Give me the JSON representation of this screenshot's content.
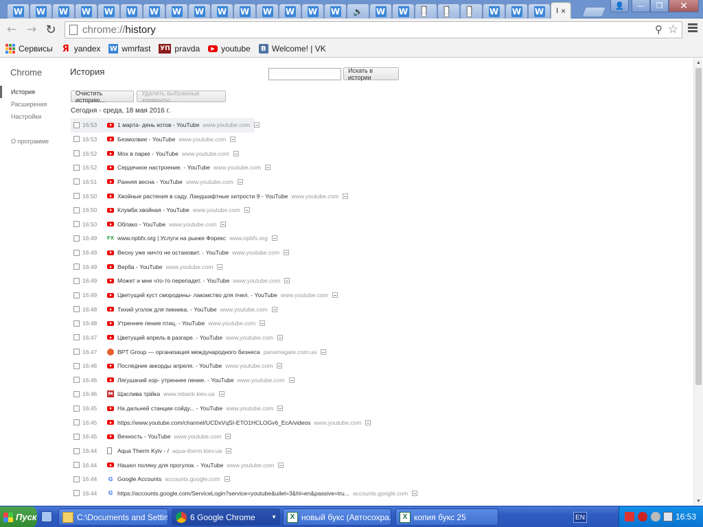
{
  "tabstrip": {
    "tabs": [
      {
        "icon": "wmrfast-icon",
        "glyph": "W"
      },
      {
        "icon": "wmrfast-icon",
        "glyph": "W"
      },
      {
        "icon": "wmrfast-icon",
        "glyph": "W"
      },
      {
        "icon": "wmrfast-icon",
        "glyph": "W"
      },
      {
        "icon": "wmrfast-icon",
        "glyph": "W"
      },
      {
        "icon": "wmrfast-icon",
        "glyph": "W"
      },
      {
        "icon": "wmrfast-icon",
        "glyph": "W"
      },
      {
        "icon": "wmrfast-icon",
        "glyph": "W"
      },
      {
        "icon": "wmrfast-icon",
        "glyph": "W"
      },
      {
        "icon": "wmrfast-icon",
        "glyph": "W"
      },
      {
        "icon": "wmrfast-icon",
        "glyph": "W"
      },
      {
        "icon": "wmrfast-icon",
        "glyph": "W"
      },
      {
        "icon": "wmrfast-icon",
        "glyph": "W"
      },
      {
        "icon": "wmrfast-icon",
        "glyph": "W"
      },
      {
        "icon": "wmrfast-icon",
        "glyph": "W"
      },
      {
        "icon": "speaker-icon",
        "glyph": "🔈"
      },
      {
        "icon": "wmrfast-icon",
        "glyph": "W"
      },
      {
        "icon": "wmrfast-icon",
        "glyph": "W"
      },
      {
        "icon": "page-icon",
        "glyph": "🗋"
      },
      {
        "icon": "page-icon",
        "glyph": "🗋"
      },
      {
        "icon": "page-icon",
        "glyph": "🗋"
      },
      {
        "icon": "wmrfast-icon",
        "glyph": "W"
      },
      {
        "icon": "wmrfast-icon",
        "glyph": "W"
      },
      {
        "icon": "wmrfast-icon",
        "glyph": "W"
      }
    ],
    "active_tab": {
      "title": "I",
      "close": "×"
    }
  },
  "toolbar": {
    "url_scheme": "chrome://",
    "url_path": "history"
  },
  "bookmarks": [
    {
      "label": "Сервисы",
      "icon": "apps-icon",
      "glyph": ""
    },
    {
      "label": "yandex",
      "icon": "yandex-icon",
      "glyph": "Я"
    },
    {
      "label": "wmrfast",
      "icon": "wmrfast-icon",
      "glyph": "W"
    },
    {
      "label": "pravda",
      "icon": "up-icon",
      "glyph": "УП"
    },
    {
      "label": "youtube",
      "icon": "youtube-icon",
      "glyph": "▶"
    },
    {
      "label": "Welcome! | VK",
      "icon": "vk-icon",
      "glyph": "B"
    }
  ],
  "sidebar": {
    "brand": "Chrome",
    "items": [
      {
        "label": "История",
        "selected": true
      },
      {
        "label": "Расширения",
        "selected": false
      },
      {
        "label": "Настройки",
        "selected": false
      }
    ],
    "about": "О программе"
  },
  "history": {
    "heading": "История",
    "search_placeholder": "",
    "search_button": "Искать в истории",
    "clear_button": "Очистить историю...",
    "remove_button": "Удалить выбранные элементы",
    "day_header": "Сегодня - среда, 18 мая 2016 г.",
    "entries": [
      {
        "time": "16:53",
        "favicon": "youtube",
        "title": "1 марта- день котов - YouTube",
        "domain": "www.youtube.com"
      },
      {
        "time": "16:53",
        "favicon": "youtube",
        "title": "Безмолвие - YouTube",
        "domain": "www.youtube.com"
      },
      {
        "time": "16:52",
        "favicon": "youtube",
        "title": "Мох в парке - YouTube",
        "domain": "www.youtube.com"
      },
      {
        "time": "16:52",
        "favicon": "youtube",
        "title": "Сердечное настроение. - YouTube",
        "domain": "www.youtube.com"
      },
      {
        "time": "16:51",
        "favicon": "youtube",
        "title": "Ранняя весна - YouTube",
        "domain": "www.youtube.com"
      },
      {
        "time": "16:50",
        "favicon": "youtube",
        "title": "Хвойные растения в саду. Ландшафтные хитрости 9 - YouTube",
        "domain": "www.youtube.com"
      },
      {
        "time": "16:50",
        "favicon": "youtube",
        "title": "Клумба хвойная - YouTube",
        "domain": "www.youtube.com"
      },
      {
        "time": "16:50",
        "favicon": "youtube",
        "title": "Облако - YouTube",
        "domain": "www.youtube.com"
      },
      {
        "time": "16:49",
        "favicon": "fx",
        "title": "www.npbfx.org | Услуги на рынке Форекс",
        "domain": "www.npbfx.org"
      },
      {
        "time": "16:49",
        "favicon": "youtube",
        "title": "Весну уже ничто не остановит. - YouTube",
        "domain": "www.youtube.com"
      },
      {
        "time": "16:49",
        "favicon": "youtube",
        "title": "Верба - YouTube",
        "domain": "www.youtube.com"
      },
      {
        "time": "16:49",
        "favicon": "youtube",
        "title": "Может и мне что-то перепадет. - YouTube",
        "domain": "www.youtube.com"
      },
      {
        "time": "16:49",
        "favicon": "youtube",
        "title": "Цветущий куст смородины- лакомство для пчел. - YouTube",
        "domain": "www.youtube.com"
      },
      {
        "time": "16:48",
        "favicon": "youtube",
        "title": "Тихий уголок для пикника. - YouTube",
        "domain": "www.youtube.com"
      },
      {
        "time": "16:48",
        "favicon": "youtube",
        "title": "Утреннее пение птиц. - YouTube",
        "domain": "www.youtube.com"
      },
      {
        "time": "16:47",
        "favicon": "youtube",
        "title": "Цветущий апрель в разгаре. - YouTube",
        "domain": "www.youtube.com"
      },
      {
        "time": "16:47",
        "favicon": "circle",
        "title": "BPT Group — организация международного бизнеса",
        "domain": "panamagate.com.ua"
      },
      {
        "time": "16:46",
        "favicon": "youtube",
        "title": "Последние аккорды апреля. - YouTube",
        "domain": "www.youtube.com"
      },
      {
        "time": "16:46",
        "favicon": "youtube",
        "title": "Лягушачий хор- утреннее пение. - YouTube",
        "domain": "www.youtube.com"
      },
      {
        "time": "16:46",
        "favicon": "m",
        "title": "Щаслива трійка",
        "domain": "www.mbank.kiev.ua"
      },
      {
        "time": "16:45",
        "favicon": "youtube",
        "title": "На дальней станции сойду... - YouTube",
        "domain": "www.youtube.com"
      },
      {
        "time": "16:45",
        "favicon": "youtube",
        "title": "https://www.youtube.com/channel/UCDxVqSI-ETO1HCLOGv6_EcA/videos",
        "domain": "www.youtube.com"
      },
      {
        "time": "16:45",
        "favicon": "youtube",
        "title": "Вечность - YouTube",
        "domain": "www.youtube.com"
      },
      {
        "time": "16:44",
        "favicon": "doc",
        "title": "Aqua Therm Kyiv - /",
        "domain": "aqua-therm.kiev.ua"
      },
      {
        "time": "16:44",
        "favicon": "youtube",
        "title": "Нашел поляну для прогулок. - YouTube",
        "domain": "www.youtube.com"
      },
      {
        "time": "16:44",
        "favicon": "google",
        "title": "Google Accounts",
        "domain": "accounts.google.com"
      },
      {
        "time": "16:44",
        "favicon": "google",
        "title": "https://accounts.google.com/ServiceLogin?service=youtube&uilel=3&hl=en&passive=tru...",
        "domain": "accounts.google.com"
      }
    ]
  },
  "taskbar": {
    "start": "Пуск",
    "tasks": [
      {
        "label": "C:\\Documents and Settin...",
        "icon": "folder-icon"
      },
      {
        "label": "6 Google Chrome",
        "icon": "chrome-icon"
      },
      {
        "label": "новый букс (Автосохра...",
        "icon": "excel-icon"
      },
      {
        "label": "копия букс 25",
        "icon": "excel-icon"
      }
    ],
    "language": "EN",
    "clock": "16:53"
  }
}
